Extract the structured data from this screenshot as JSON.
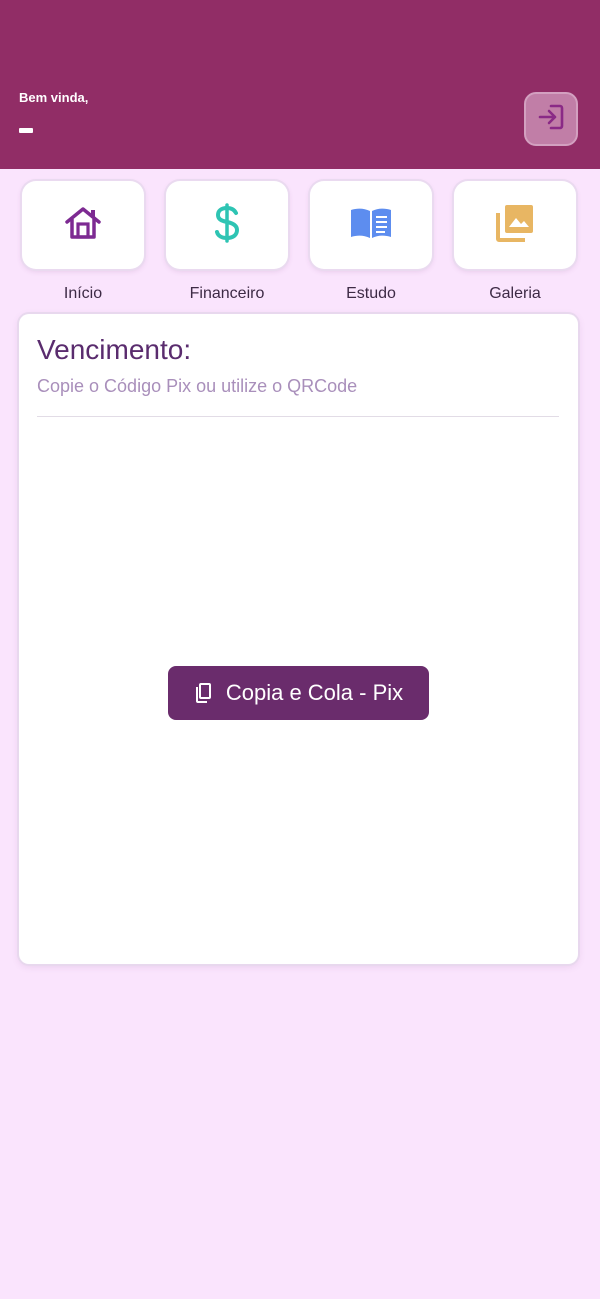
{
  "header": {
    "greeting": "Bem vinda,",
    "username": "-",
    "logout_icon": "login-arrow-icon",
    "background_color": "#912d66"
  },
  "nav": {
    "items": [
      {
        "label": "Início",
        "icon": "home-icon",
        "color": "#7d2a92"
      },
      {
        "label": "Financeiro",
        "icon": "dollar-icon",
        "color": "#2ec4b3"
      },
      {
        "label": "Estudo",
        "icon": "book-icon",
        "color": "#5d8def"
      },
      {
        "label": "Galeria",
        "icon": "gallery-icon",
        "color": "#e8b663"
      }
    ]
  },
  "card": {
    "title": "Vencimento:",
    "subtitle": "Copie o Código Pix ou utilize o QRCode",
    "pix_button_label": "Copia e Cola - Pix",
    "pix_button_icon": "copy-icon",
    "button_color": "#6a2c6c"
  }
}
